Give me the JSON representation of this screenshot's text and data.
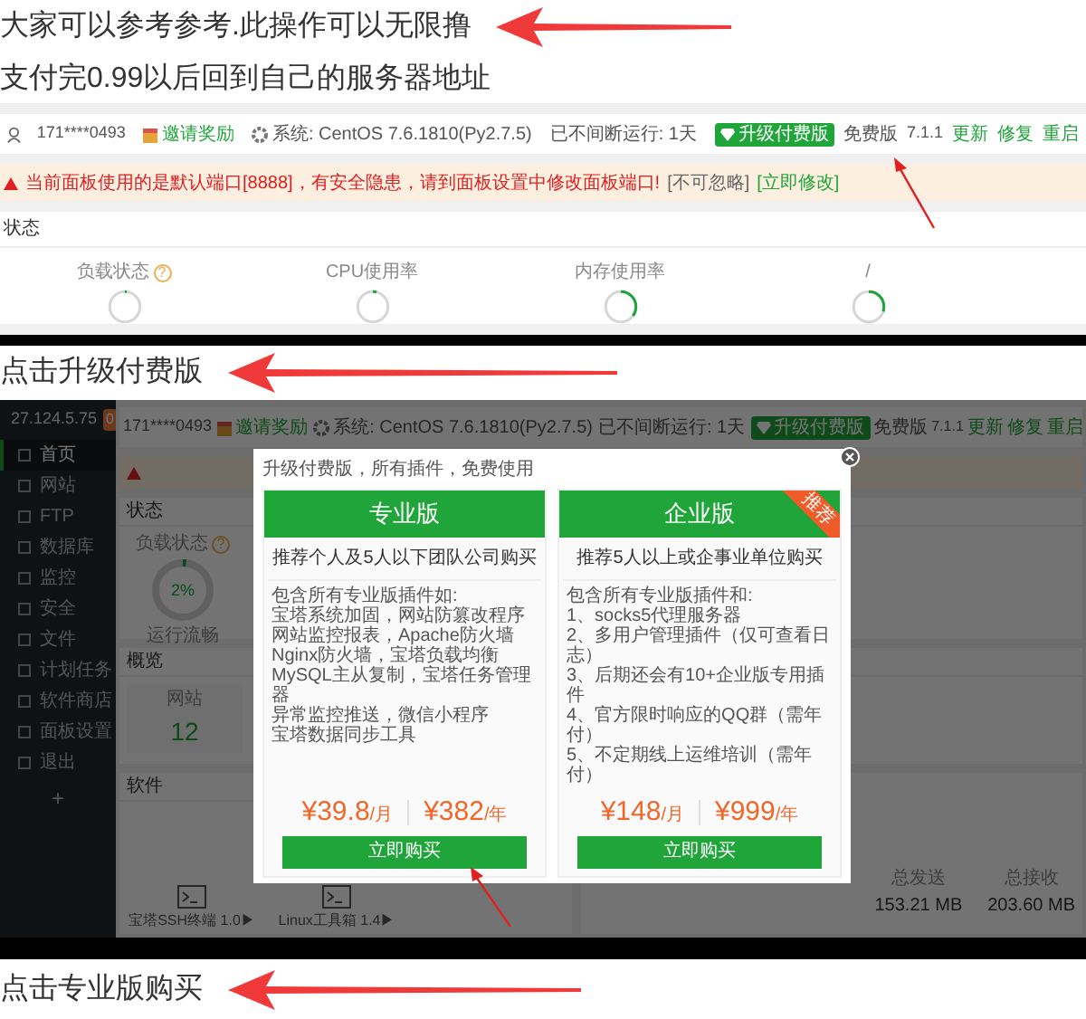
{
  "caption_1": {
    "text": "大家可以参考参考.此操作可以无限撸",
    "arrow": true
  },
  "caption_2": {
    "text": "支付完0.99以后回到自己的服务器地址",
    "arrow": false
  },
  "screenshot_1": {
    "header": {
      "user": "171****0493",
      "invite": "邀请奖励",
      "system": "系统: CentOS 7.6.1810(Py2.7.5)",
      "uptime": "已不间断运行: 1天",
      "upgrade": "升级付费版",
      "edition": "免费版",
      "version": "7.1.1",
      "actions": [
        "更新",
        "修复",
        "重启"
      ]
    },
    "warning": {
      "message": "当前面板使用的是默认端口[8888]，有安全隐患，请到面板设置中修改面板端口!",
      "ignore": "[不可忽略]",
      "fix": "[立即修改]"
    },
    "status": {
      "title": "状态",
      "gauges": [
        {
          "label": "负载状态",
          "help": "?",
          "level": 0.02
        },
        {
          "label": "CPU使用率",
          "level": 0.04
        },
        {
          "label": "内存使用率",
          "level": 0.35
        },
        {
          "label": "/",
          "level": 0.3
        }
      ]
    }
  },
  "caption_3": {
    "text": "点击升级付费版",
    "arrow": true
  },
  "screenshot_2": {
    "sidebar": {
      "host": "27.124.5.75",
      "badge": "0",
      "items": [
        {
          "label": "首页",
          "selected": true
        },
        {
          "label": "网站",
          "selected": false
        },
        {
          "label": "FTP",
          "selected": false
        },
        {
          "label": "数据库",
          "selected": false
        },
        {
          "label": "监控",
          "selected": false
        },
        {
          "label": "安全",
          "selected": false
        },
        {
          "label": "文件",
          "selected": false
        },
        {
          "label": "计划任务",
          "selected": false
        },
        {
          "label": "软件商店",
          "selected": false
        },
        {
          "label": "面板设置",
          "selected": false
        },
        {
          "label": "退出",
          "selected": false
        }
      ],
      "add": "+"
    },
    "header": {
      "user": "171****0493",
      "invite": "邀请奖励",
      "system": "系统: CentOS 7.6.1810(Py2.7.5)",
      "uptime": "已不间断运行: 1天",
      "upgrade": "升级付费版",
      "edition": "免费版",
      "version": "7.1.1",
      "actions": [
        "更新",
        "修复",
        "重启"
      ]
    },
    "status": {
      "title": "状态",
      "gauge": {
        "label": "负载状态",
        "help": "?",
        "value": "2%",
        "state": "运行流畅",
        "level": 0.02
      }
    },
    "overview": {
      "title": "概览",
      "stat": {
        "label": "网站",
        "value": "12"
      }
    },
    "software": {
      "title": "软件",
      "items": [
        "宝塔SSH终端 1.0▶",
        "Linux工具箱 1.4▶"
      ]
    },
    "traffic": [
      {
        "label": "总发送",
        "value": "153.21 MB"
      },
      {
        "label": "总接收",
        "value": "203.60 MB"
      }
    ],
    "modal": {
      "notice": "升级付费版，所有插件，免费使用",
      "plans": [
        {
          "name": "专业版",
          "recommended": false,
          "subtitle": "推荐个人及5人以下团队公司购买",
          "features": [
            "包含所有专业版插件如:",
            "宝塔系统加固，网站防篡改程序",
            "网站监控报表，Apache防火墙",
            "Nginx防火墙，宝塔负载均衡",
            "MySQL主从复制，宝塔任务管理器",
            "异常监控推送，微信小程序",
            "宝塔数据同步工具"
          ],
          "prices": [
            {
              "amount": "¥39.8",
              "unit": "/月"
            },
            {
              "amount": "¥382",
              "unit": "/年"
            }
          ],
          "button": "立即购买"
        },
        {
          "name": "企业版",
          "recommended": true,
          "ribbon": "推荐",
          "subtitle": "推荐5人以上或企事业单位购买",
          "features": [
            "包含所有专业版插件和:",
            "1、socks5代理服务器",
            "2、多用户管理插件（仅可查看日志）",
            "3、后期还会有10+企业版专用插件",
            "4、官方限时响应的QQ群（需年付）",
            "5、不定期线上运维培训（需年付）"
          ],
          "prices": [
            {
              "amount": "¥148",
              "unit": "/月"
            },
            {
              "amount": "¥999",
              "unit": "/年"
            }
          ],
          "button": "立即购买"
        }
      ]
    }
  },
  "caption_4": {
    "text": "点击专业版购买",
    "arrow": true
  }
}
